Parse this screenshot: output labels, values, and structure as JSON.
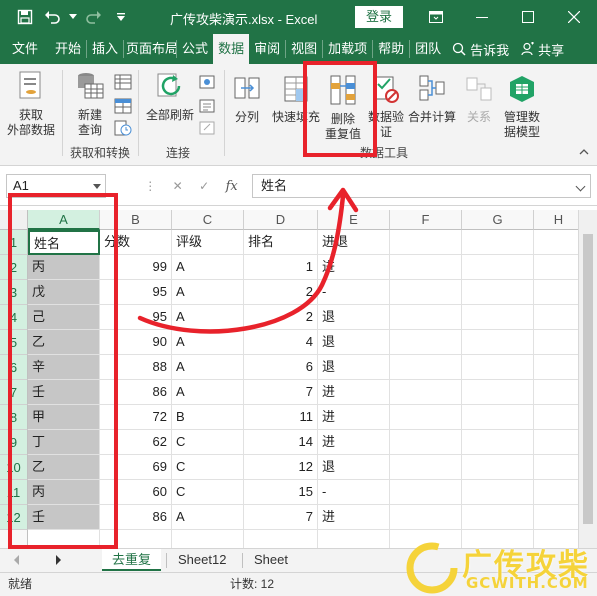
{
  "window": {
    "title": "广传攻柴演示.xlsx  -  Excel",
    "login_label": "登录"
  },
  "tabs": [
    {
      "label": "文件",
      "active": false
    },
    {
      "label": "开始",
      "active": false
    },
    {
      "label": "插入",
      "active": false
    },
    {
      "label": "页面布局",
      "active": false
    },
    {
      "label": "公式",
      "active": false
    },
    {
      "label": "数据",
      "active": true
    },
    {
      "label": "审阅",
      "active": false
    },
    {
      "label": "视图",
      "active": false
    },
    {
      "label": "加载项",
      "active": false
    },
    {
      "label": "帮助",
      "active": false
    },
    {
      "label": "团队",
      "active": false
    }
  ],
  "tell_me": "告诉我",
  "share": "共享",
  "ribbon": {
    "get_data": "获取\n外部数据",
    "new_query": "新建\n查询",
    "refresh_all": "全部刷新",
    "split": "分列",
    "flash_fill": "快速填充",
    "remove_duplicates": "删除\n重复值",
    "data_validation": "数据验\n证",
    "consolidate": "合并计算",
    "relationships": "关系",
    "manage_model": "管理数\n据模型",
    "groups": {
      "get_transform": "获取和转换",
      "connections": "连接",
      "data_tools": "数据工具"
    }
  },
  "formula_bar": {
    "name_box": "A1",
    "cancel": "✕",
    "enter": "✓",
    "fx": "fx",
    "content": "姓名"
  },
  "grid": {
    "columns": [
      "A",
      "B",
      "C",
      "D",
      "E",
      "F",
      "G",
      "H"
    ],
    "headers": [
      "姓名",
      "分数",
      "评级",
      "排名",
      "进退"
    ],
    "rows": [
      {
        "n": "2",
        "name": "丙",
        "score": "99",
        "grade": "A",
        "rank": "1",
        "status": "进"
      },
      {
        "n": "3",
        "name": "戊",
        "score": "95",
        "grade": "A",
        "rank": "2",
        "status": "-"
      },
      {
        "n": "4",
        "name": "己",
        "score": "95",
        "grade": "A",
        "rank": "2",
        "status": "退"
      },
      {
        "n": "5",
        "name": "乙",
        "score": "90",
        "grade": "A",
        "rank": "4",
        "status": "退"
      },
      {
        "n": "6",
        "name": "辛",
        "score": "88",
        "grade": "A",
        "rank": "6",
        "status": "退"
      },
      {
        "n": "7",
        "name": "壬",
        "score": "86",
        "grade": "A",
        "rank": "7",
        "status": "进"
      },
      {
        "n": "8",
        "name": "甲",
        "score": "72",
        "grade": "B",
        "rank": "11",
        "status": "进"
      },
      {
        "n": "9",
        "name": "丁",
        "score": "62",
        "grade": "C",
        "rank": "14",
        "status": "进"
      },
      {
        "n": "10",
        "name": "乙",
        "score": "69",
        "grade": "C",
        "rank": "12",
        "status": "退"
      },
      {
        "n": "11",
        "name": "丙",
        "score": "60",
        "grade": "C",
        "rank": "15",
        "status": "-"
      },
      {
        "n": "12",
        "name": "壬",
        "score": "86",
        "grade": "A",
        "rank": "7",
        "status": "进"
      }
    ],
    "first_row_number": "1"
  },
  "sheets": [
    {
      "label": "去重复",
      "active": true
    },
    {
      "label": "Sheet12",
      "active": false
    },
    {
      "label": "Sheet",
      "active": false
    }
  ],
  "status": {
    "ready": "就绪",
    "count": "计数: 12"
  },
  "watermark": {
    "text": "广传攻柴",
    "sub": "GCWITH.COM"
  },
  "colors": {
    "excel_green": "#217346",
    "annotation_red": "#e8222b",
    "watermark_yellow": "#f5d33a"
  }
}
